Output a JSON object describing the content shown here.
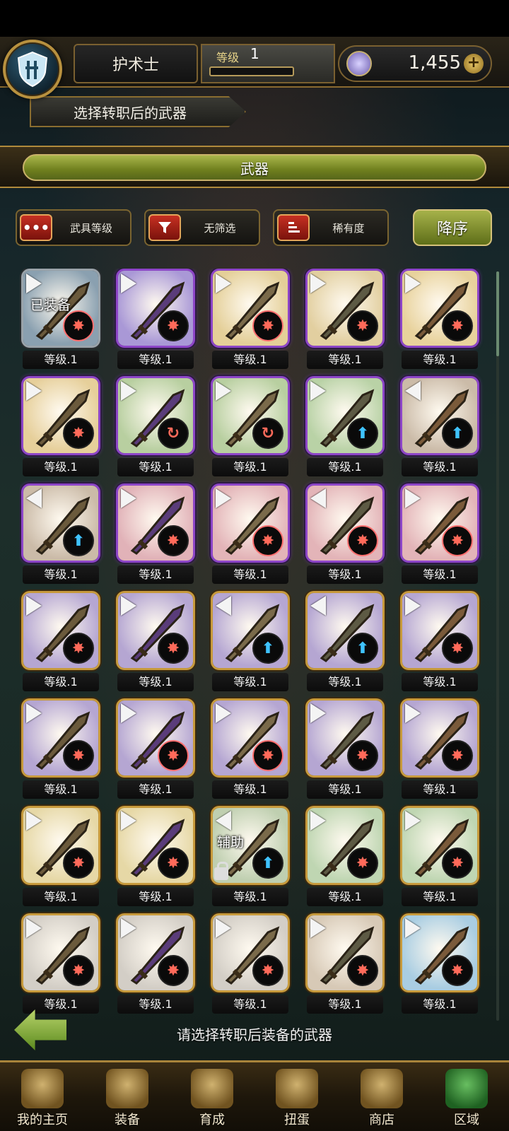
{
  "header": {
    "class_name": "护术士",
    "level_label": "等级",
    "level_value": "1",
    "currency_value": "1,455",
    "currency_icon": "gem-icon",
    "add_currency_icon": "plus-icon"
  },
  "banner": {
    "text": "选择转职后的武器"
  },
  "tabs": {
    "weapons_label": "武器"
  },
  "filters": {
    "sort_key_label": "武具等级",
    "sort_key_icon": "dots-icon",
    "filter_label": "无筛选",
    "filter_icon": "funnel-icon",
    "rarity_label": "稀有度",
    "rarity_icon": "list-icon",
    "order_label": "降序"
  },
  "weapons": [
    {
      "level": "等级.1",
      "frame": "silver",
      "bg": "#8aa0b0",
      "badge": "fire",
      "ring": true,
      "tri": "right",
      "equipped": true,
      "label": "已装备"
    },
    {
      "level": "等级.1",
      "frame": "purple",
      "bg": "#a998d6",
      "badge": "fire",
      "ring": false,
      "tri": "right"
    },
    {
      "level": "等级.1",
      "frame": "purple",
      "bg": "#e4cf98",
      "badge": "fire",
      "ring": true,
      "tri": "right"
    },
    {
      "level": "等级.1",
      "frame": "purple",
      "bg": "#e2cfa0",
      "badge": "fire",
      "ring": false,
      "tri": "right"
    },
    {
      "level": "等级.1",
      "frame": "purple",
      "bg": "#e8d29c",
      "badge": "fire",
      "ring": false,
      "tri": "right"
    },
    {
      "level": "等级.1",
      "frame": "purple",
      "bg": "#e6cf9a",
      "badge": "fire",
      "ring": false,
      "tri": "right"
    },
    {
      "level": "等级.1",
      "frame": "purple",
      "bg": "#b8cfa0",
      "badge": "spin",
      "ring": false,
      "tri": "right"
    },
    {
      "level": "等级.1",
      "frame": "purple",
      "bg": "#b8cfa0",
      "badge": "spin",
      "ring": false,
      "tri": "right"
    },
    {
      "level": "等级.1",
      "frame": "purple",
      "bg": "#b9d2a6",
      "badge": "up",
      "ring": false,
      "tri": "right"
    },
    {
      "level": "等级.1",
      "frame": "purple",
      "bg": "#cbbba8",
      "badge": "up",
      "ring": false,
      "tri": "left"
    },
    {
      "level": "等级.1",
      "frame": "purple",
      "bg": "#cbbba8",
      "badge": "up",
      "ring": false,
      "tri": "left"
    },
    {
      "level": "等级.1",
      "frame": "purple",
      "bg": "#e1b2b8",
      "badge": "fire",
      "ring": false,
      "tri": "right"
    },
    {
      "level": "等级.1",
      "frame": "purple",
      "bg": "#e3b4b8",
      "badge": "fire",
      "ring": true,
      "tri": "right"
    },
    {
      "level": "等级.1",
      "frame": "purple",
      "bg": "#e3b4b8",
      "badge": "fire",
      "ring": true,
      "tri": "left"
    },
    {
      "level": "等级.1",
      "frame": "purple",
      "bg": "#e3b4b8",
      "badge": "fire",
      "ring": true,
      "tri": "right"
    },
    {
      "level": "等级.1",
      "frame": "gold",
      "bg": "#b5a6d2",
      "badge": "fire",
      "ring": false,
      "tri": "right"
    },
    {
      "level": "等级.1",
      "frame": "gold",
      "bg": "#b5a6d2",
      "badge": "fire",
      "ring": false,
      "tri": "right"
    },
    {
      "level": "等级.1",
      "frame": "gold",
      "bg": "#b5a6d2",
      "badge": "up",
      "ring": false,
      "tri": "left"
    },
    {
      "level": "等级.1",
      "frame": "gold",
      "bg": "#b5a6d2",
      "badge": "up",
      "ring": false,
      "tri": "left"
    },
    {
      "level": "等级.1",
      "frame": "gold",
      "bg": "#b5a6d2",
      "badge": "fire",
      "ring": false,
      "tri": "right"
    },
    {
      "level": "等级.1",
      "frame": "gold",
      "bg": "#b5a6d2",
      "badge": "fire",
      "ring": false,
      "tri": "right"
    },
    {
      "level": "等级.1",
      "frame": "gold",
      "bg": "#b5a6d2",
      "badge": "fire",
      "ring": true,
      "tri": "right"
    },
    {
      "level": "等级.1",
      "frame": "gold",
      "bg": "#b5a6d2",
      "badge": "fire",
      "ring": true,
      "tri": "right"
    },
    {
      "level": "等级.1",
      "frame": "gold",
      "bg": "#b5a6d2",
      "badge": "fire",
      "ring": false,
      "tri": "right"
    },
    {
      "level": "等级.1",
      "frame": "gold",
      "bg": "#b5a6d2",
      "badge": "fire",
      "ring": false,
      "tri": "right"
    },
    {
      "level": "等级.1",
      "frame": "gold",
      "bg": "#e6d8a6",
      "badge": "fire",
      "ring": false,
      "tri": "right"
    },
    {
      "level": "等级.1",
      "frame": "gold",
      "bg": "#e6d8a6",
      "badge": "fire",
      "ring": false,
      "tri": "right"
    },
    {
      "level": "等级.1",
      "frame": "gold",
      "bg": "#bfcfb0",
      "badge": "up",
      "ring": false,
      "tri": "left",
      "support": true,
      "label": "辅助",
      "locked": true
    },
    {
      "level": "等级.1",
      "frame": "gold",
      "bg": "#bfd6b2",
      "badge": "fire",
      "ring": false,
      "tri": "right"
    },
    {
      "level": "等级.1",
      "frame": "gold",
      "bg": "#bfd6b2",
      "badge": "fire",
      "ring": false,
      "tri": "right"
    },
    {
      "level": "等级.1",
      "frame": "gold",
      "bg": "#d3cec6",
      "badge": "fire",
      "ring": false,
      "tri": "right"
    },
    {
      "level": "等级.1",
      "frame": "gold",
      "bg": "#d3cec6",
      "badge": "fire",
      "ring": false,
      "tri": "right"
    },
    {
      "level": "等级.1",
      "frame": "gold",
      "bg": "#d3cec6",
      "badge": "fire",
      "ring": false,
      "tri": "right"
    },
    {
      "level": "等级.1",
      "frame": "gold",
      "bg": "#d7c9b6",
      "badge": "fire",
      "ring": false,
      "tri": "right"
    },
    {
      "level": "等级.1",
      "frame": "gold",
      "bg": "#a9cde2",
      "badge": "fire",
      "ring": false,
      "tri": "right"
    }
  ],
  "footer": {
    "prompt": "请选择转职后装备的武器",
    "back_icon": "back-arrow-icon"
  },
  "bottom_nav": [
    {
      "label": "我的主页",
      "icon": "scroll-icon",
      "active": false
    },
    {
      "label": "装备",
      "icon": "helmet-icon",
      "active": false
    },
    {
      "label": "育成",
      "icon": "sword-icon",
      "active": false
    },
    {
      "label": "扭蛋",
      "icon": "gacha-icon",
      "active": false
    },
    {
      "label": "商店",
      "icon": "shop-icon",
      "active": false
    },
    {
      "label": "区域",
      "icon": "globe-icon",
      "active": true
    }
  ]
}
